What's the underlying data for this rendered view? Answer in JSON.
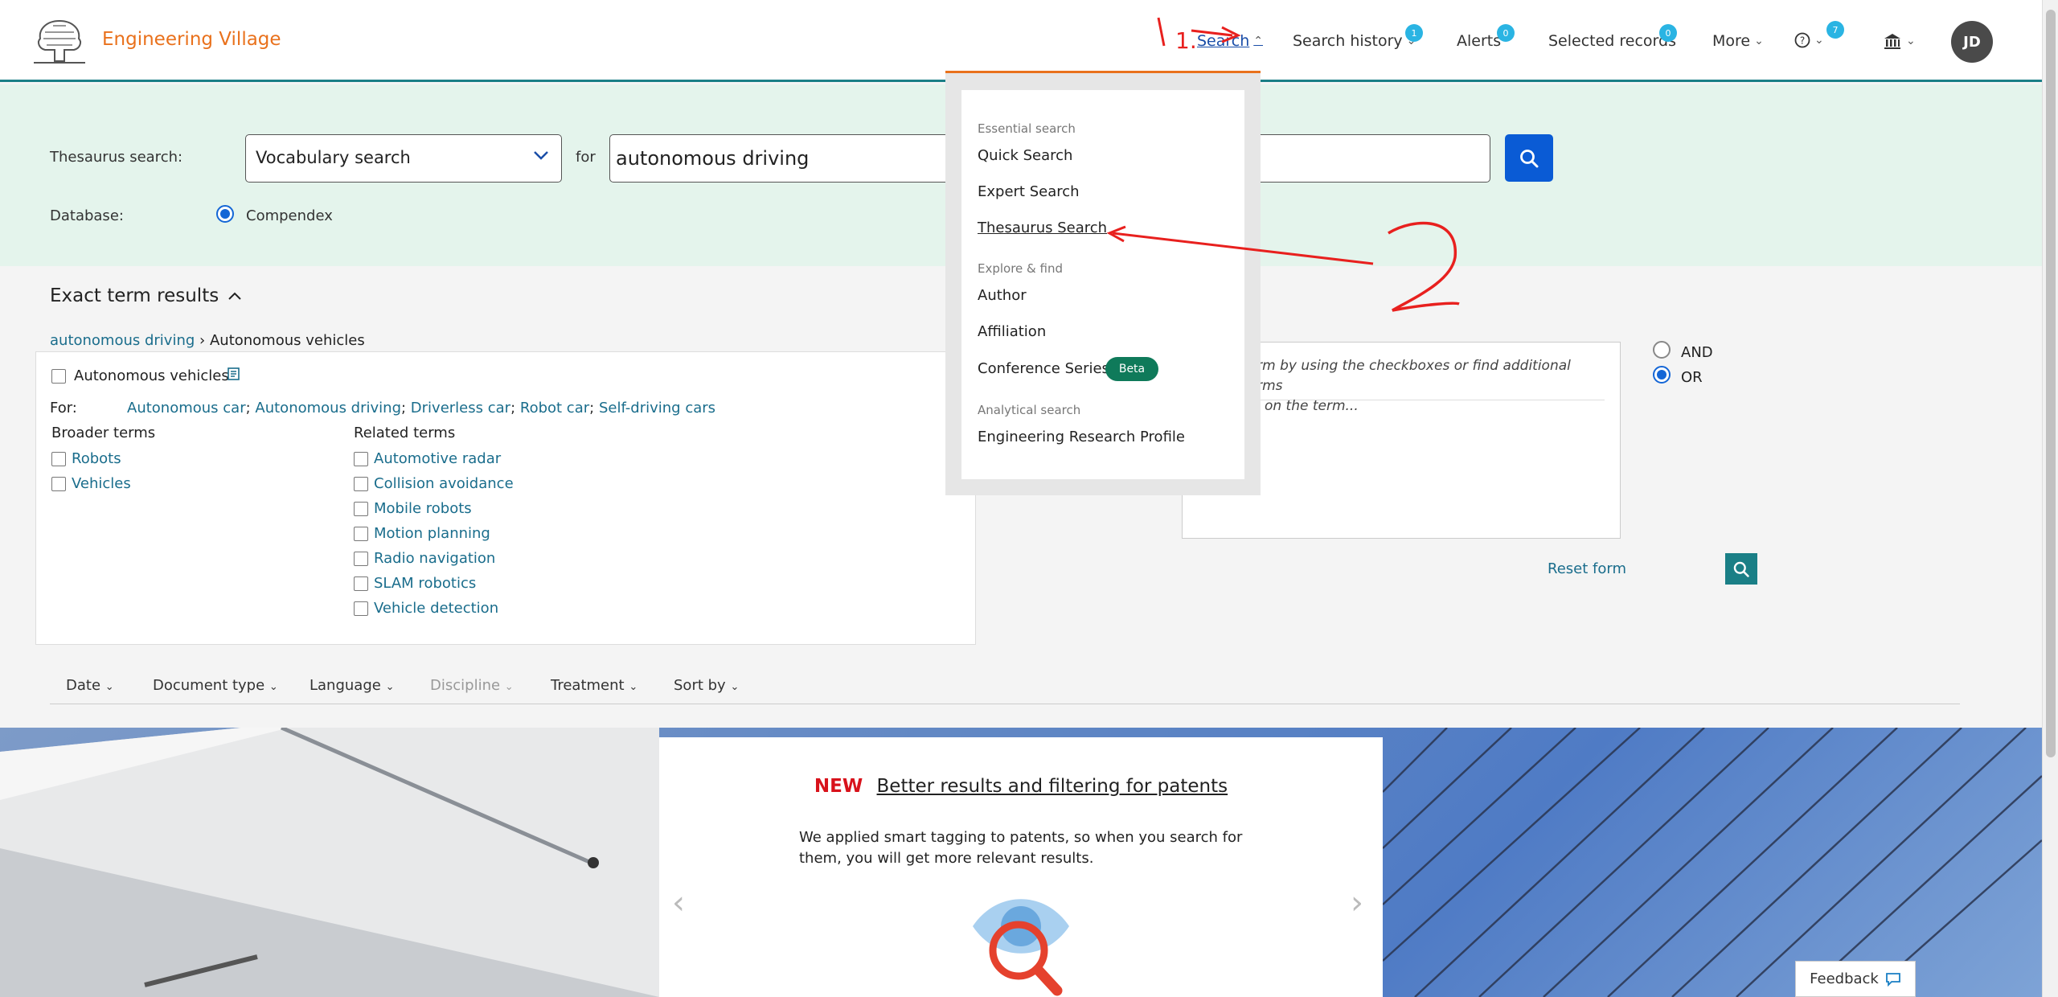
{
  "header": {
    "brand": "Engineering Village",
    "nav": {
      "search": "Search",
      "search_history": "Search history",
      "search_history_count": "1",
      "alerts": "Alerts",
      "alerts_count": "0",
      "selected_records": "Selected records",
      "selected_records_count": "0",
      "more": "More",
      "help_count": "7"
    },
    "avatar_initials": "JD"
  },
  "search_form": {
    "thesaurus_label": "Thesaurus search:",
    "vocab_select": "Vocabulary search",
    "for_label": "for",
    "term_value": "autonomous driving",
    "database_label": "Database:",
    "database_option": "Compendex"
  },
  "results": {
    "title": "Exact term results",
    "breadcrumb_link": "autonomous driving",
    "breadcrumb_current": "Autonomous vehicles",
    "main_term": "Autonomous vehicles",
    "for_label": "For:",
    "for_terms": [
      "Autonomous car",
      "Autonomous driving",
      "Driverless car",
      "Robot car",
      "Self-driving cars"
    ],
    "broader_label": "Broader terms",
    "broader_terms": [
      "Robots",
      "Vehicles"
    ],
    "related_label": "Related terms",
    "related_terms": [
      "Automotive radar",
      "Collision avoidance",
      "Mobile robots",
      "Motion planning",
      "Radio navigation",
      "SLAM robotics",
      "Vehicle detection"
    ]
  },
  "combine": {
    "and_label": "AND",
    "or_label": "OR",
    "hint_line1": "term by using the checkboxes or find additional terms",
    "hint_line2": "ng on the term...",
    "reset_label": "Reset form"
  },
  "filters": [
    "Date",
    "Document type",
    "Language",
    "Discipline",
    "Treatment",
    "Sort by"
  ],
  "hero": {
    "new_label": "NEW",
    "headline": "Better results and filtering for patents",
    "body": "We applied smart tagging to patents, so when you search for them, you will get more relevant results."
  },
  "feedback_label": "Feedback",
  "search_menu": {
    "essential_heading": "Essential search",
    "quick": "Quick Search",
    "expert": "Expert Search",
    "thesaurus": "Thesaurus Search",
    "explore_heading": "Explore & find",
    "author": "Author",
    "affiliation": "Affiliation",
    "conference": "Conference Series",
    "beta_badge": "Beta",
    "analytical_heading": "Analytical search",
    "erp": "Engineering Research Profile"
  },
  "annotations": {
    "step1": "1.",
    "step2": "2",
    "color": "#e8201e"
  },
  "colors": {
    "brand": "#e9711c",
    "accent_blue": "#0a5bd5",
    "teal": "#1a7f86",
    "band": "#e4f4ec",
    "link": "#1a6d8c",
    "badge": "#2ab4e3",
    "beta": "#0f7a5a"
  }
}
